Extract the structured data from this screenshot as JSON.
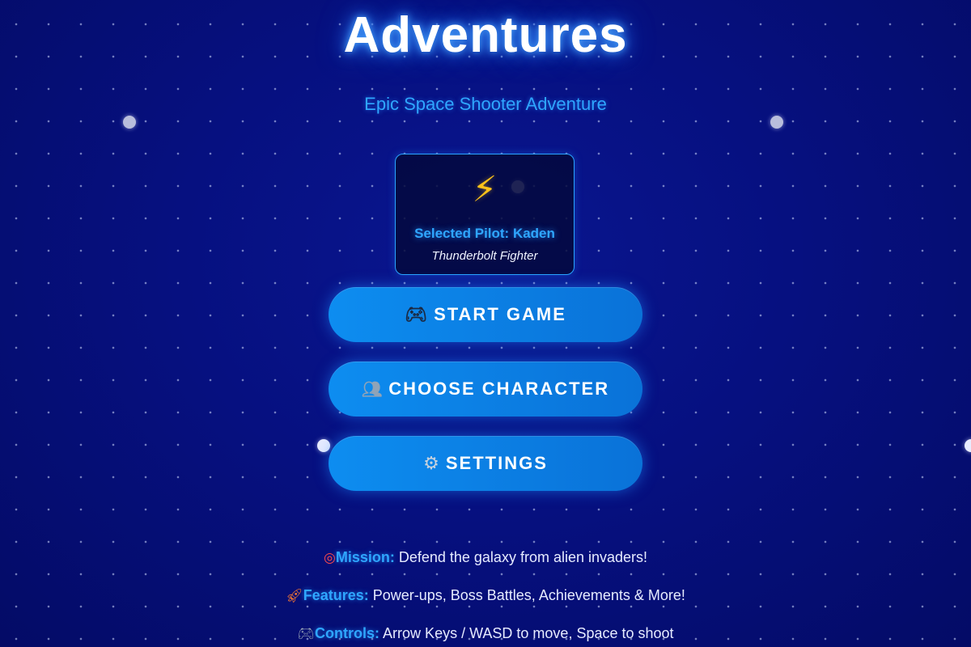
{
  "game": {
    "title": "Adventures",
    "subtitle": "Epic Space Shooter Adventure"
  },
  "pilot": {
    "icon": "lightning-bolt",
    "name_text": "Selected Pilot: Kaden",
    "ship": "Thunderbolt Fighter"
  },
  "menu": {
    "start": {
      "icon": "gamepad-icon",
      "label": "START GAME"
    },
    "character": {
      "icon": "people-icon",
      "label": "CHOOSE CHARACTER"
    },
    "settings": {
      "icon": "gear-icon",
      "label": "SETTINGS"
    }
  },
  "info": {
    "mission": {
      "icon": "target-icon",
      "label": "Mission:",
      "text": " Defend the galaxy from alien invaders!"
    },
    "features": {
      "icon": "rocket-icon",
      "label": "Features:",
      "text": " Power-ups, Boss Battles, Achievements & More!"
    },
    "controls": {
      "icon": "gamepad-icon",
      "label": "Controls:",
      "text": " Arrow Keys / WASD to move, Space to shoot"
    }
  },
  "colors": {
    "background": "#061080",
    "accent": "#2fa6ff",
    "button": "#0d8df0",
    "bolt": "#ffc21a"
  }
}
